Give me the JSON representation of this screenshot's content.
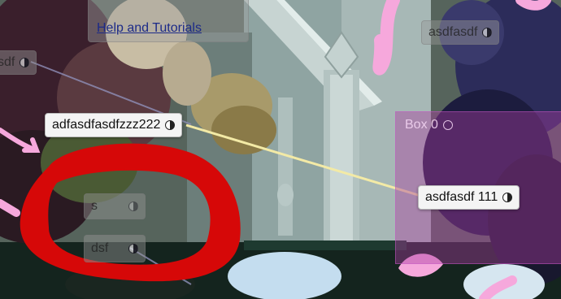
{
  "help_menu": {
    "link_label": "Help and Tutorials"
  },
  "nodes": {
    "top_right": {
      "label": "asdfasdf"
    },
    "left_edge": {
      "label": "sdf"
    },
    "center_left": {
      "label": "adfasdfasdfzzz222"
    },
    "right_center": {
      "label": "asdfasdf 111"
    },
    "s_node": {
      "label": "s"
    },
    "dsf_node": {
      "label": "dsf"
    }
  },
  "box": {
    "title": "Box 0"
  },
  "colors": {
    "highlight_connection": "#f3eaa6",
    "dim_connection": "#8f8fb8",
    "annotation_red": "#d60808",
    "pink_strokes": "#f6a8dc",
    "box_fill": "#aa3ca0"
  }
}
